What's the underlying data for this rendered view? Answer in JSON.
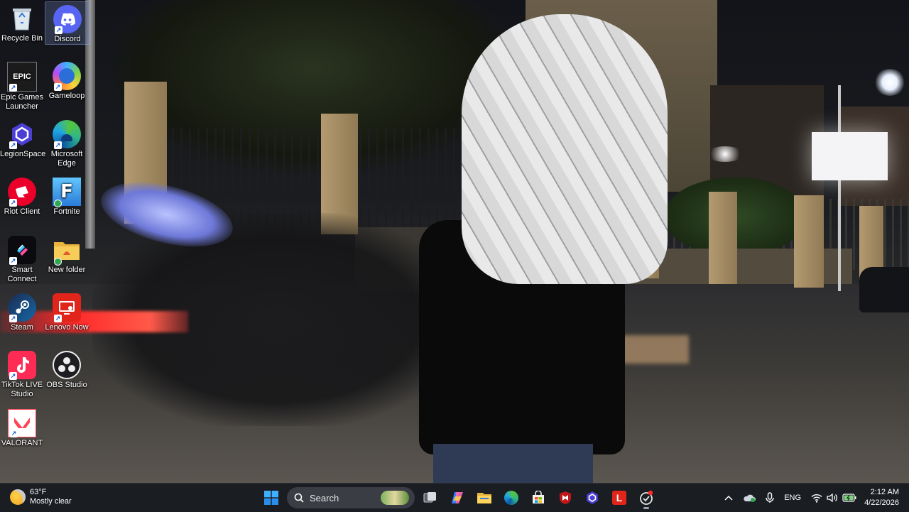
{
  "desktop_icons": [
    {
      "label": "Recycle Bin",
      "icon": "recycle-bin-icon"
    },
    {
      "label": "Discord",
      "icon": "discord-icon",
      "selected": true
    },
    {
      "label": "Epic Games Launcher",
      "icon": "epic-games-icon",
      "glyph": "EPIC"
    },
    {
      "label": "Gameloop",
      "icon": "gameloop-icon"
    },
    {
      "label": "LegionSpace",
      "icon": "legion-space-icon"
    },
    {
      "label": "Microsoft Edge",
      "icon": "edge-icon"
    },
    {
      "label": "Riot Client",
      "icon": "riot-client-icon"
    },
    {
      "label": "Fortnite",
      "icon": "fortnite-icon",
      "glyph": "F"
    },
    {
      "label": "Smart Connect",
      "icon": "smart-connect-icon"
    },
    {
      "label": "New folder",
      "icon": "folder-icon"
    },
    {
      "label": "Steam",
      "icon": "steam-icon"
    },
    {
      "label": "Lenovo Now",
      "icon": "lenovo-now-icon"
    },
    {
      "label": "TikTok LIVE Studio",
      "icon": "tiktok-live-icon"
    },
    {
      "label": "OBS Studio",
      "icon": "obs-studio-icon"
    },
    {
      "label": "VALORANT",
      "icon": "valorant-icon"
    }
  ],
  "taskbar": {
    "weather": {
      "temp": "63°F",
      "condition": "Mostly clear",
      "icon": "weather-moon-icon"
    },
    "search_label": "Search",
    "pinned": [
      {
        "name": "task-view",
        "icon": "task-view-icon"
      },
      {
        "name": "copilot",
        "icon": "copilot-icon"
      },
      {
        "name": "file-explorer",
        "icon": "file-explorer-icon"
      },
      {
        "name": "edge",
        "icon": "edge-icon"
      },
      {
        "name": "microsoft-store",
        "icon": "store-icon"
      },
      {
        "name": "mcafee",
        "icon": "mcafee-icon"
      },
      {
        "name": "legion-space",
        "icon": "legion-space-icon"
      },
      {
        "name": "lenovo-vantage",
        "icon": "lenovo-l-icon",
        "glyph": "L"
      },
      {
        "name": "recording-app",
        "icon": "record-icon",
        "active": true
      }
    ],
    "tray": {
      "language": "ENG",
      "time": "2:12 AM",
      "date": "4/22/2026"
    }
  },
  "colors": {
    "taskbar_bg": "#1c1e24",
    "accent": "#1a5fd6",
    "discord": "#5865f2",
    "riot": "#eb0029",
    "lenovo_red": "#e1251b"
  }
}
